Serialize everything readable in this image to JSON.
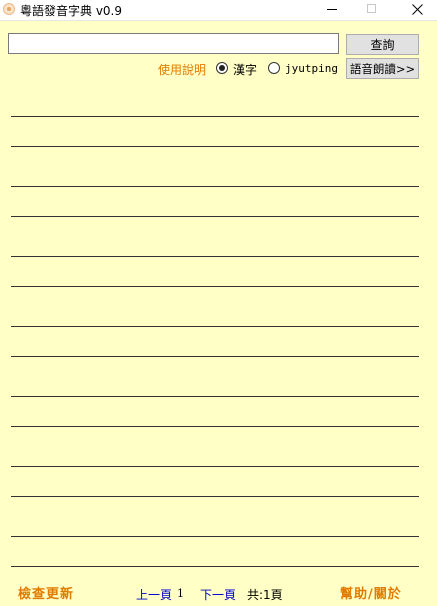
{
  "window": {
    "title": "粵語發音字典 v0.9",
    "icon": "app-icon"
  },
  "search": {
    "value": "",
    "placeholder": "",
    "query_button": "查詢"
  },
  "options": {
    "help_label": "使用說明",
    "mode_selected": "漢字",
    "modes": [
      "漢字",
      "jyutping"
    ],
    "tts_button": "語音朗讀>>"
  },
  "results": {
    "rows": [
      "",
      "",
      "",
      "",
      "",
      "",
      "",
      "",
      "",
      "",
      "",
      "",
      "",
      "",
      ""
    ]
  },
  "footer": {
    "update_label": "檢查更新",
    "prev_label": "上一頁",
    "page_number": "1",
    "next_label": "下一頁",
    "total_label": "共:1頁",
    "help_about_label": "幫助/關於"
  },
  "colors": {
    "background": "#ffffc6",
    "accent": "#e07b00",
    "link": "#0000cc"
  }
}
